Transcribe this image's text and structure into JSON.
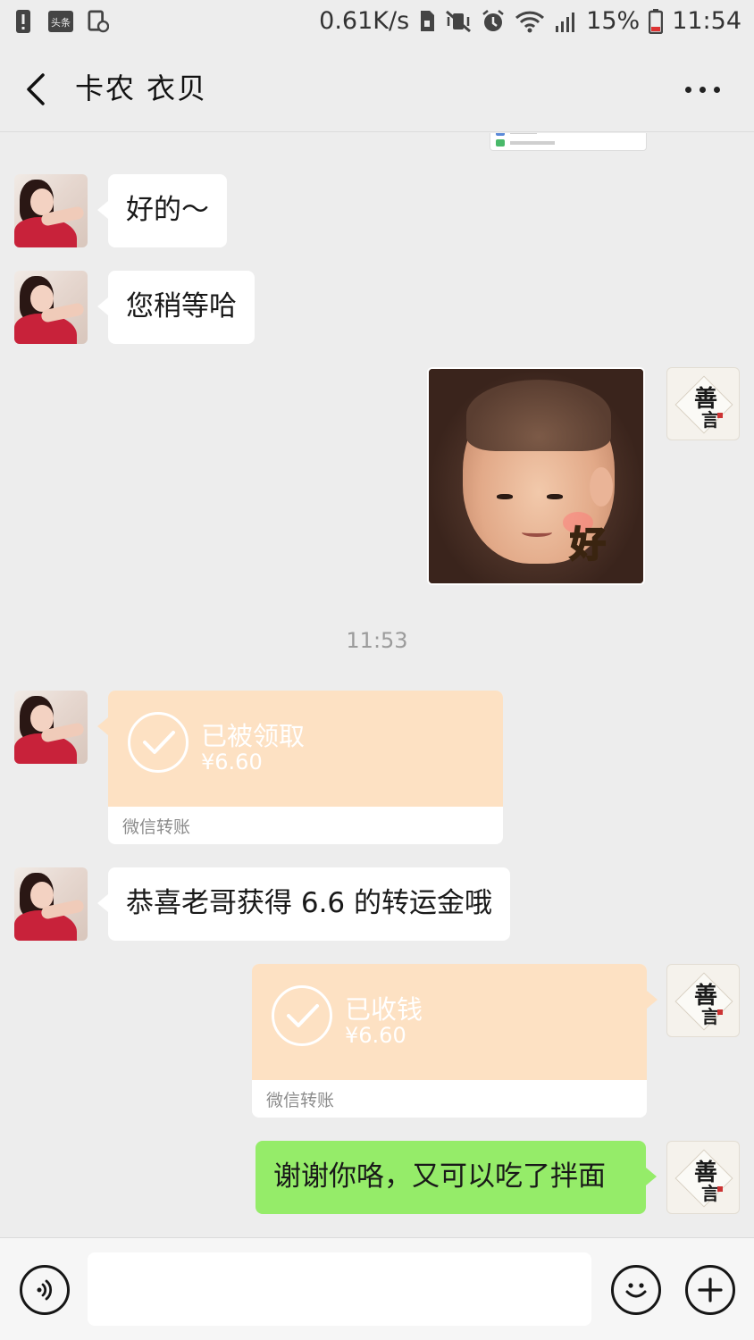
{
  "status_bar": {
    "speed": "0.61K/s",
    "battery": "15%",
    "time": "11:54",
    "app_badge": "头条"
  },
  "header": {
    "title": "卡农  衣贝"
  },
  "messages": {
    "m1": {
      "text": "好的～"
    },
    "m2": {
      "text": "您稍等哈"
    },
    "sticker": {
      "caption": "好"
    },
    "time": "11:53",
    "transfer_in": {
      "status": "已被领取",
      "amount": "¥6.60",
      "footer": "微信转账"
    },
    "m3": {
      "text": "恭喜老哥获得 6.6 的转运金哦"
    },
    "transfer_out": {
      "status": "已收钱",
      "amount": "¥6.60",
      "footer": "微信转账"
    },
    "m4": {
      "text": "谢谢你咯，又可以吃了拌面"
    }
  },
  "avatar_right": {
    "c1": "善",
    "c2": "言"
  },
  "input": {
    "value": ""
  },
  "colors": {
    "background": "#ededed",
    "bubble_self": "#95ec69",
    "transfer": "#fde1c3"
  }
}
